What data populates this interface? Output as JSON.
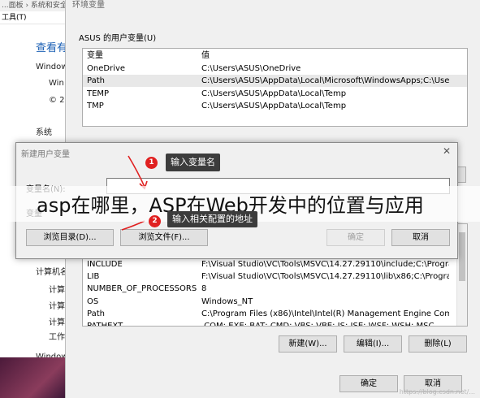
{
  "background_window": {
    "top_text": "...面板 › 系统和安全 ›",
    "menu_label": "工具(T)",
    "heading": "查看有",
    "line1": "Window",
    "line2": "Win",
    "line3": "© 2",
    "section": "系统",
    "computer_label": "计算机名",
    "item1": "计算",
    "item2": "计算",
    "item3": "计算",
    "item4": "工作",
    "bottom": "Window"
  },
  "env_window": {
    "title": "环境变量",
    "user_group_label": "ASUS 的用户变量(U)",
    "user_vars": {
      "headers": [
        "变量",
        "值"
      ],
      "rows": [
        [
          "OneDrive",
          "C:\\Users\\ASUS\\OneDrive"
        ],
        [
          "Path",
          "C:\\Users\\ASUS\\AppData\\Local\\Microsoft\\WindowsApps;C:\\Use..."
        ],
        [
          "TEMP",
          "C:\\Users\\ASUS\\AppData\\Local\\Temp"
        ],
        [
          "TMP",
          "C:\\Users\\ASUS\\AppData\\Local\\Temp"
        ]
      ]
    },
    "sys_vars": {
      "rows": [
        [
          "INCLUDE",
          "F:\\Visual Studio\\VC\\Tools\\MSVC\\14.27.29110\\include;C:\\Progra..."
        ],
        [
          "LIB",
          "F:\\Visual Studio\\VC\\Tools\\MSVC\\14.27.29110\\lib\\x86;C:\\Progra..."
        ],
        [
          "NUMBER_OF_PROCESSORS",
          "8"
        ],
        [
          "OS",
          "Windows_NT"
        ],
        [
          "Path",
          "C:\\Program Files (x86)\\Intel\\Intel(R) Management Engine Comp..."
        ],
        [
          "PATHEXT",
          ".COM;.EXE;.BAT;.CMD;.VBS;.VBE;.JS;.JSE;.WSF;.WSH;.MSC"
        ]
      ]
    },
    "buttons": {
      "new": "新建(W)...",
      "edit": "编辑(I)...",
      "delete": "删除(L)",
      "ok": "确定",
      "cancel": "取消"
    }
  },
  "dialog": {
    "title": "新建用户变量",
    "close": "✕",
    "name_label": "变量名(N):",
    "value_label": "变量",
    "browse_dir": "浏览目录(D)...",
    "browse_file": "浏览文件(F)...",
    "ok": "确定",
    "cancel": "取消"
  },
  "callouts": {
    "c1_num": "1",
    "c1_text": "输入变量名",
    "c2_num": "2",
    "c2_text": "输入相关配置的地址"
  },
  "overlay_title": "asp在哪里，ASP在Web开发中的位置与应用",
  "watermark": "https://blog.csdn.net/...",
  "colors": {
    "callout_bg": "#3c3c3c",
    "badge_red": "#e02020",
    "link_blue": "#1a5fb4"
  }
}
